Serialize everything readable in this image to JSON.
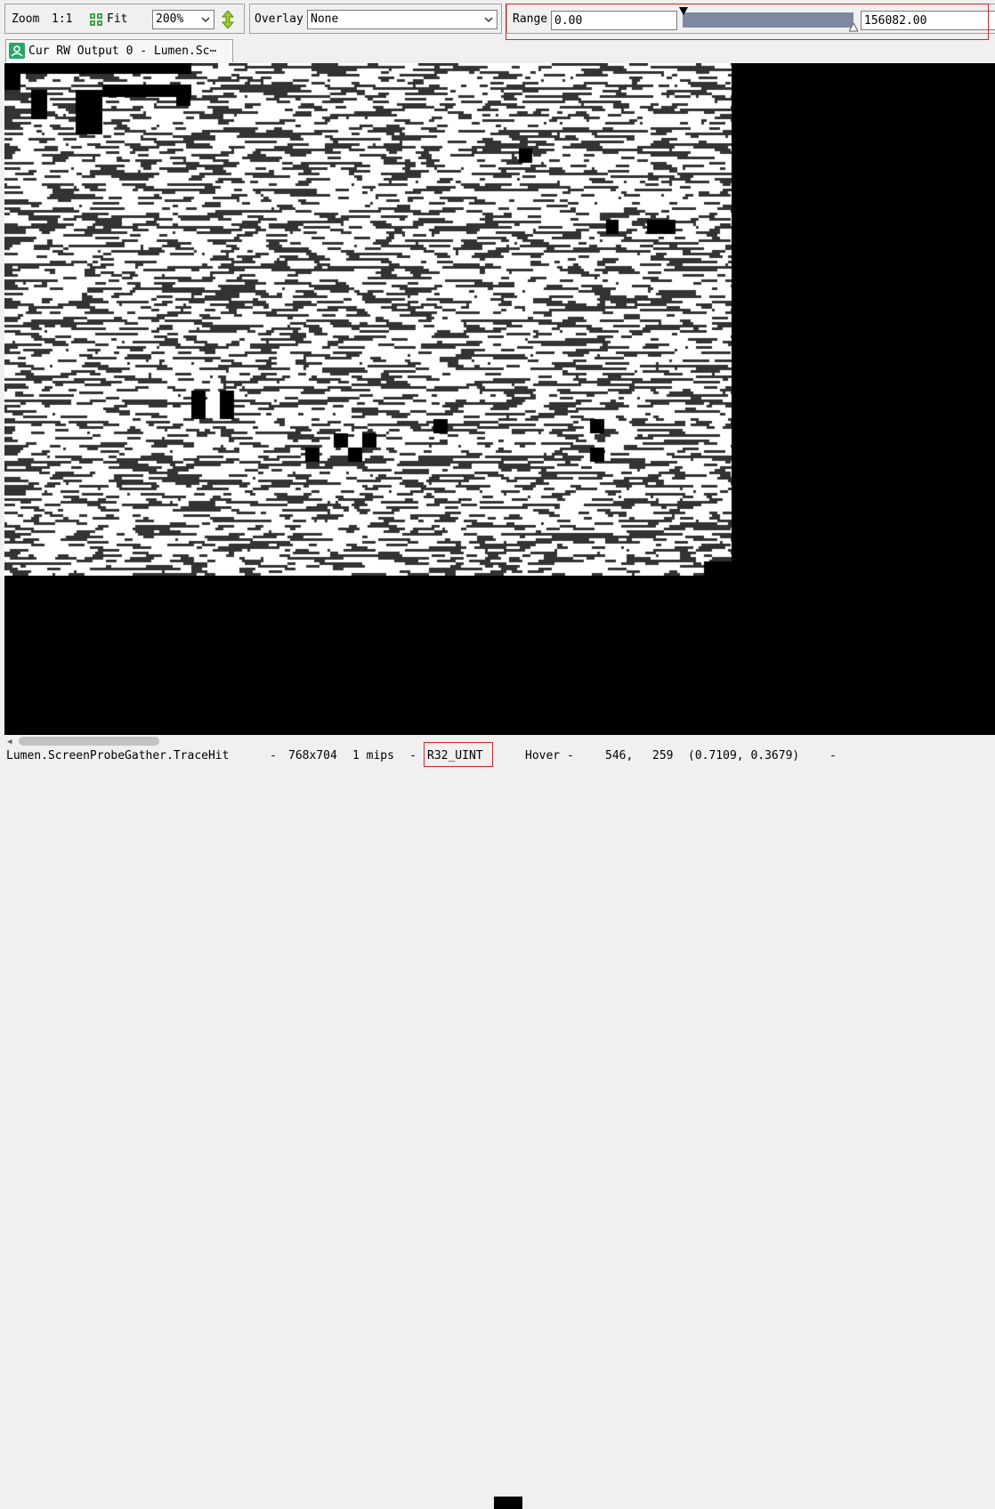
{
  "toolbar": {
    "zoom_label": "Zoom",
    "one_to_one_label": "1:1",
    "fit_label": "Fit",
    "zoom_value": "200%",
    "overlay_label": "Overlay",
    "overlay_value": "None",
    "range_label": "Range",
    "range_min": "0.00",
    "range_max": "156082.00"
  },
  "tab": {
    "title": "Cur RW Output 0 - Lumen.Sc⋯"
  },
  "status": {
    "resource_name": "Lumen.ScreenProbeGather.TraceHit",
    "sep1": "-",
    "dimensions": "768x704",
    "mips": "1 mips",
    "sep2": "-",
    "format": "R32_UINT",
    "hover_label": "Hover -",
    "hover_x": "546,",
    "hover_y": "259",
    "hover_uv": "(0.7109, 0.3679)",
    "sep3": "-"
  },
  "colors": {
    "highlight": "#e02020",
    "slider": "#7d8aa0",
    "texture_white": "#ffffff",
    "texture_dark": "#333333",
    "background": "#000000"
  },
  "icons": [
    "fit-icon",
    "flip-icon",
    "chevron-down-icon",
    "texture-tab-icon",
    "slider-min-marker",
    "slider-max-marker"
  ]
}
